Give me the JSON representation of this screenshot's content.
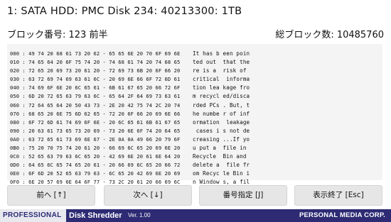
{
  "header": {
    "title": "1:  SATA HDD: PMC Disk 234: 40213300: 1TB"
  },
  "block_info": {
    "block_number_label": "ブロック番号: 123 前半",
    "total_blocks_label": "総ブロック数: 10485760"
  },
  "dump": {
    "hex_lines": [
      "000 : 49 74 20 68 61 73 20 62 - 65 65 6E 20 70 6F 69 6E",
      "010 : 74 65 64 20 6F 75 74 20 - 74 68 61 74 20 74 68 65",
      "020 : 72 65 20 69 73 20 61 20 - 72 69 73 6B 20 6F 66 20",
      "030 : 63 72 69 74 69 63 61 6C - 20 69 6E 66 6F 72 6D 61",
      "040 : 74 69 6F 6E 20 6C 65 61 - 6B 61 67 65 20 66 72 6F",
      "050 : 6D 20 72 65 63 79 63 6C - 65 64 2F 64 69 73 63 61",
      "060 : 72 64 65 64 20 50 43 73 - 2E 20 42 75 74 2C 20 74",
      "070 : 68 65 20 6E 75 6D 62 65 - 72 20 6F 66 20 69 6E 66",
      "080 : 6F 72 6D 61 74 69 6F 6E - 20 6C 65 61 6B 61 67 65",
      "090 : 20 63 61 73 65 73 20 69 - 73 20 6E 6F 74 20 64 65",
      "0A0 : 63 72 65 61 73 69 6E 67 - 2E 0A 0A 49 66 20 79 6F",
      "0B0 : 75 20 70 75 74 20 61 20 - 66 69 6C 65 20 69 6E 20",
      "0C0 : 52 65 63 79 63 6C 65 20 - 42 69 6E 20 61 6E 64 20",
      "0D0 : 64 65 6C 65 74 65 20 61 - 20 66 69 6C 65 20 66 72",
      "0E0 : 6F 6D 20 52 65 63 79 63 - 6C 65 20 42 69 6E 20 69",
      "0F0 : 6E 20 57 69 6E 64 6F 77 - 73 2C 20 61 20 66 69 6C"
    ],
    "ascii_lines": [
      "It has b een poin",
      "ted out  that the",
      "re is a  risk of",
      "critical  informa",
      "tion lea kage fro",
      "m recycl ed/disca",
      "rded PCs . But, t",
      "he numbe r of inf",
      "ormation  leakage",
      " cases i s not de",
      "creasing ...If yo",
      "u put a  file in",
      "Recycle  Bin and",
      "delete a  file fr",
      "om Recyc le Bin i",
      "n Window s, a fil"
    ]
  },
  "buttons": {
    "prev": "前へ [↑]",
    "next": "次へ [↓]",
    "goto": "番号指定 [J]",
    "exit": "表示終了 [Esc]"
  },
  "footer": {
    "brand": "PROFESSIONAL",
    "product": "Disk Shredder",
    "version": "Ver. 1.00",
    "company": "PERSONAL MEDIA CORP."
  }
}
